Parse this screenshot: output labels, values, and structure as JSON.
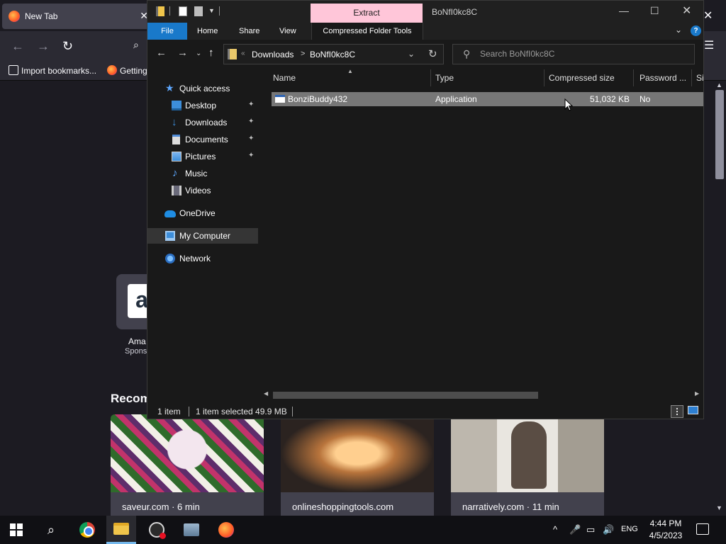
{
  "firefox": {
    "tab_title": "New Tab",
    "tab_close": "✕",
    "window_close": "✕",
    "nav": {
      "back": "←",
      "forward": "→",
      "reload": "↻",
      "search": "⌕",
      "menu": "☰"
    },
    "bookmarks": [
      {
        "label": "Import bookmarks...",
        "icon": "import-icon"
      },
      {
        "label": "Getting",
        "icon": "firefox-icon"
      }
    ],
    "shortcut": {
      "logo_letter": "a",
      "label": "Ama",
      "sponsor": "Spons"
    },
    "recommended_heading": "Recom",
    "cards": [
      {
        "source": "saveur.com · 6 min"
      },
      {
        "source": "onlineshoppingtools.com"
      },
      {
        "source": "narratively.com · 11 min"
      }
    ]
  },
  "explorer": {
    "extract_tab": "Extract",
    "window_title": "BoNfI0kc8C",
    "controls": {
      "minimize": "—",
      "maximize": "☐",
      "close": "✕"
    },
    "ribbon": {
      "tabs": [
        "File",
        "Home",
        "Share",
        "View",
        "Compressed Folder Tools"
      ],
      "collapse": "⌄",
      "help": "?"
    },
    "address": {
      "back": "←",
      "forward": "→",
      "recent": "⌄",
      "up": "↑",
      "chevron": "«",
      "crumbs": [
        "Downloads",
        "BoNfI0kc8C"
      ],
      "separator": ">",
      "dropdown": "⌄",
      "refresh": "↻"
    },
    "search": {
      "icon": "⚲",
      "placeholder": "Search BoNfI0kc8C"
    },
    "nav_pane": [
      {
        "label": "Quick access",
        "icon": "star-icon"
      },
      {
        "label": "Desktop",
        "icon": "desktop-icon",
        "pinned": true
      },
      {
        "label": "Downloads",
        "icon": "downloads-icon",
        "pinned": true
      },
      {
        "label": "Documents",
        "icon": "documents-icon",
        "pinned": true
      },
      {
        "label": "Pictures",
        "icon": "pictures-icon",
        "pinned": true
      },
      {
        "label": "Music",
        "icon": "music-icon"
      },
      {
        "label": "Videos",
        "icon": "videos-icon"
      },
      {
        "label": "OneDrive",
        "icon": "onedrive-icon"
      },
      {
        "label": "My Computer",
        "icon": "computer-icon",
        "selected": true
      },
      {
        "label": "Network",
        "icon": "network-icon"
      }
    ],
    "pin_glyph": "📌",
    "columns": [
      "Name",
      "Type",
      "Compressed size",
      "Password ...",
      "Si"
    ],
    "files": [
      {
        "name": "BonziBuddy432",
        "type": "Application",
        "compressed_size": "51,032 KB",
        "password": "No"
      }
    ],
    "status": {
      "count": "1 item",
      "selection": "1 item selected  49.9 MB"
    }
  },
  "taskbar": {
    "search_glyph": "⌕",
    "tray": {
      "chevron": "^",
      "mic": "🎤",
      "network": "▭",
      "volume": "🔊",
      "lang": "ENG",
      "time": "4:44 PM",
      "date": "4/5/2023"
    }
  },
  "colors": {
    "accent": "#1979ca",
    "extract_tab": "#ffc6d9",
    "selection": "#777777"
  }
}
